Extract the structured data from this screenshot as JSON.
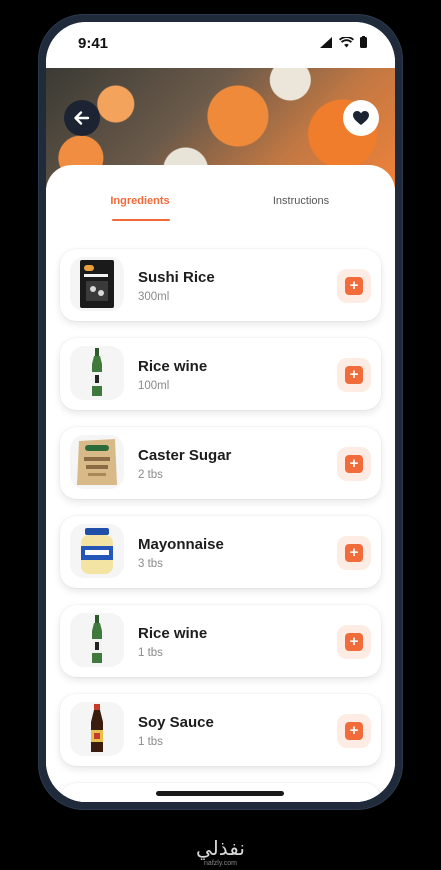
{
  "status": {
    "time": "9:41"
  },
  "tabs": [
    {
      "label": "Ingredients",
      "active": true
    },
    {
      "label": "Instructions",
      "active": false
    }
  ],
  "ingredients": [
    {
      "name": "Sushi Rice",
      "qty": "300ml",
      "icon": "rice-bag-icon"
    },
    {
      "name": "Rice wine",
      "qty": "100ml",
      "icon": "bottle-icon"
    },
    {
      "name": "Caster Sugar",
      "qty": "2 tbs",
      "icon": "sugar-bag-icon"
    },
    {
      "name": "Mayonnaise",
      "qty": "3 tbs",
      "icon": "mayo-jar-icon"
    },
    {
      "name": "Rice wine",
      "qty": "1 tbs",
      "icon": "bottle-icon"
    },
    {
      "name": "Soy Sauce",
      "qty": "1 tbs",
      "icon": "soy-bottle-icon"
    }
  ],
  "add_label": "+",
  "watermark": {
    "text": "نفذلي",
    "sub": "nafzly.com"
  },
  "colors": {
    "accent": "#f26b3a",
    "accent_soft": "#fdece4",
    "frame": "#1f2a3a"
  }
}
